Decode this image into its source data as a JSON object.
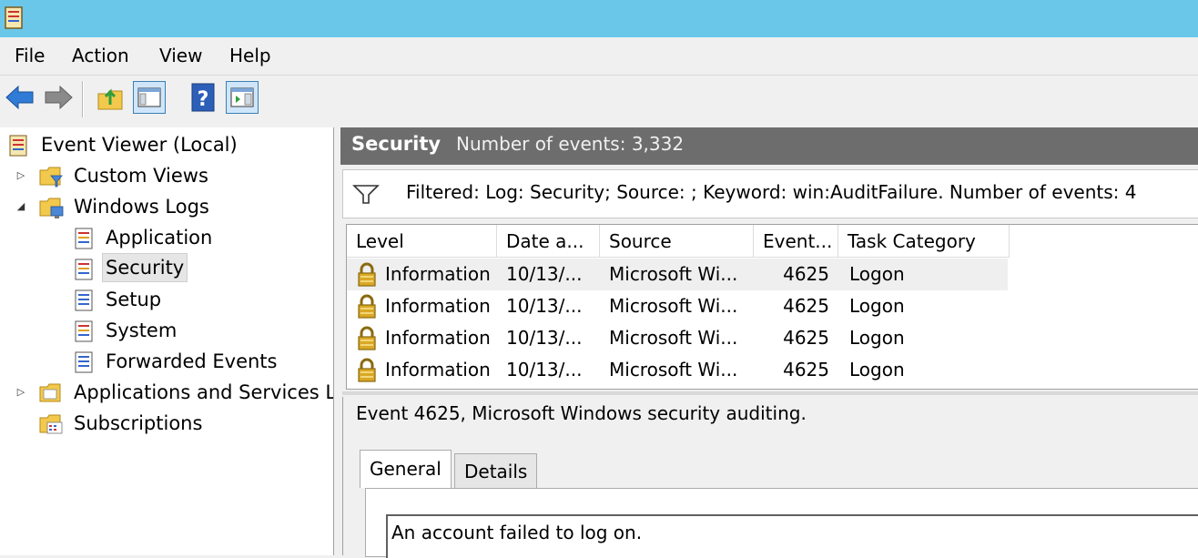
{
  "menu": {
    "file": "File",
    "action": "Action",
    "view": "View",
    "help": "Help"
  },
  "tree": {
    "root": "Event Viewer (Local)",
    "custom_views": "Custom Views",
    "windows_logs": "Windows Logs",
    "application": "Application",
    "security": "Security",
    "setup": "Setup",
    "system": "System",
    "forwarded_events": "Forwarded Events",
    "apps_services": "Applications and Services Lo",
    "subscriptions": "Subscriptions"
  },
  "log_header": {
    "title": "Security",
    "count": "Number of events: 3,332"
  },
  "filter": {
    "text": "Filtered: Log: Security; Source: ; Keyword: win:AuditFailure. Number of events: 4"
  },
  "table": {
    "headers": [
      "Level",
      "Date a...",
      "Source",
      "Event...",
      "Task Category"
    ],
    "rows": [
      [
        "Information",
        "10/13/...",
        "Microsoft Wi...",
        "4625",
        "Logon"
      ],
      [
        "Information",
        "10/13/...",
        "Microsoft Wi...",
        "4625",
        "Logon"
      ],
      [
        "Information",
        "10/13/...",
        "Microsoft Wi...",
        "4625",
        "Logon"
      ],
      [
        "Information",
        "10/13/...",
        "Microsoft Wi...",
        "4625",
        "Logon"
      ]
    ]
  },
  "detail": {
    "title": "Event 4625, Microsoft Windows security auditing.",
    "tabs": [
      "General",
      "Details"
    ],
    "description": "An account failed to log on."
  },
  "colors": {
    "titlebar": "#6ac7ea",
    "header_bar": "#6d6d6d",
    "accent_blue": "#2f7bd6",
    "lock_gold": "#d9a826"
  }
}
